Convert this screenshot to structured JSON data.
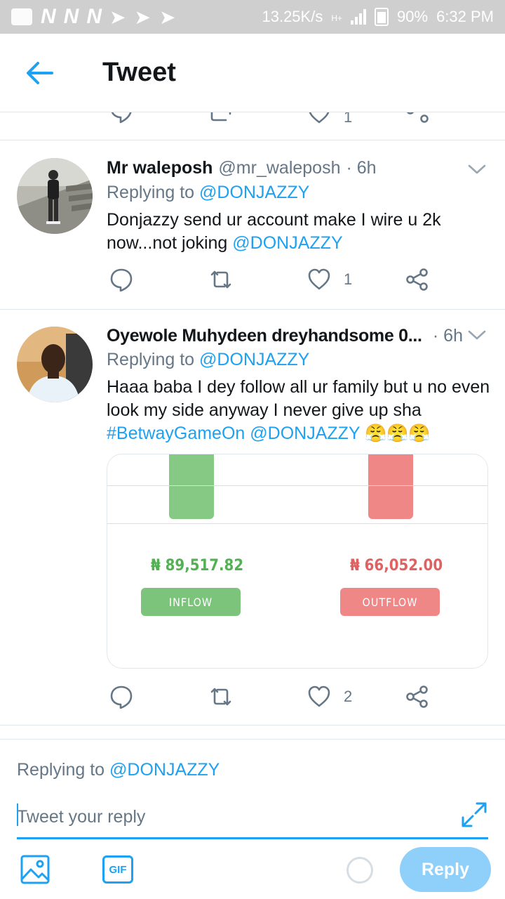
{
  "status_bar": {
    "n1": "N",
    "n2": "N",
    "n3": "N",
    "speed": "13.25K/s",
    "network": "H+",
    "battery": "90%",
    "time": "6:32 PM"
  },
  "header": {
    "title": "Tweet"
  },
  "partial_row": {
    "like_count": "1"
  },
  "tweets": [
    {
      "name": "Mr waleposh",
      "handle": "@mr_waleposh",
      "time": "· 6h",
      "replying_label": "Replying to",
      "replying_to": "@DONJAZZY",
      "text_1": "Donjazzy send ur account make I wire u 2k now...not joking",
      "text_mention": "@DONJAZZY",
      "like_count": "1"
    },
    {
      "name": "Oyewole Muhydeen dreyhandsome 0...",
      "time": "· 6h",
      "replying_label": "Replying to",
      "replying_to": "@DONJAZZY",
      "text_1": "Haaa baba I dey follow all ur family but u no even look my side anyway I never give up sha",
      "hashtag": "#BetwayGameOn",
      "text_mention": "@DONJAZZY",
      "emoji": "😤😤😤",
      "like_count": "2",
      "media": {
        "inflow_amount": "₦ 89,517.82",
        "outflow_amount": "₦ 66,052.00",
        "inflow_label": "INFLOW",
        "outflow_label": "OUTFLOW"
      }
    }
  ],
  "composer": {
    "replying_label": "Replying to",
    "replying_to": "@DONJAZZY",
    "placeholder": "Tweet your reply",
    "gif_label": "GIF",
    "reply_button": "Reply"
  },
  "colors": {
    "accent": "#1da1f2",
    "secondary_text": "#657786",
    "inflow": "#52b152",
    "outflow": "#e06161"
  }
}
